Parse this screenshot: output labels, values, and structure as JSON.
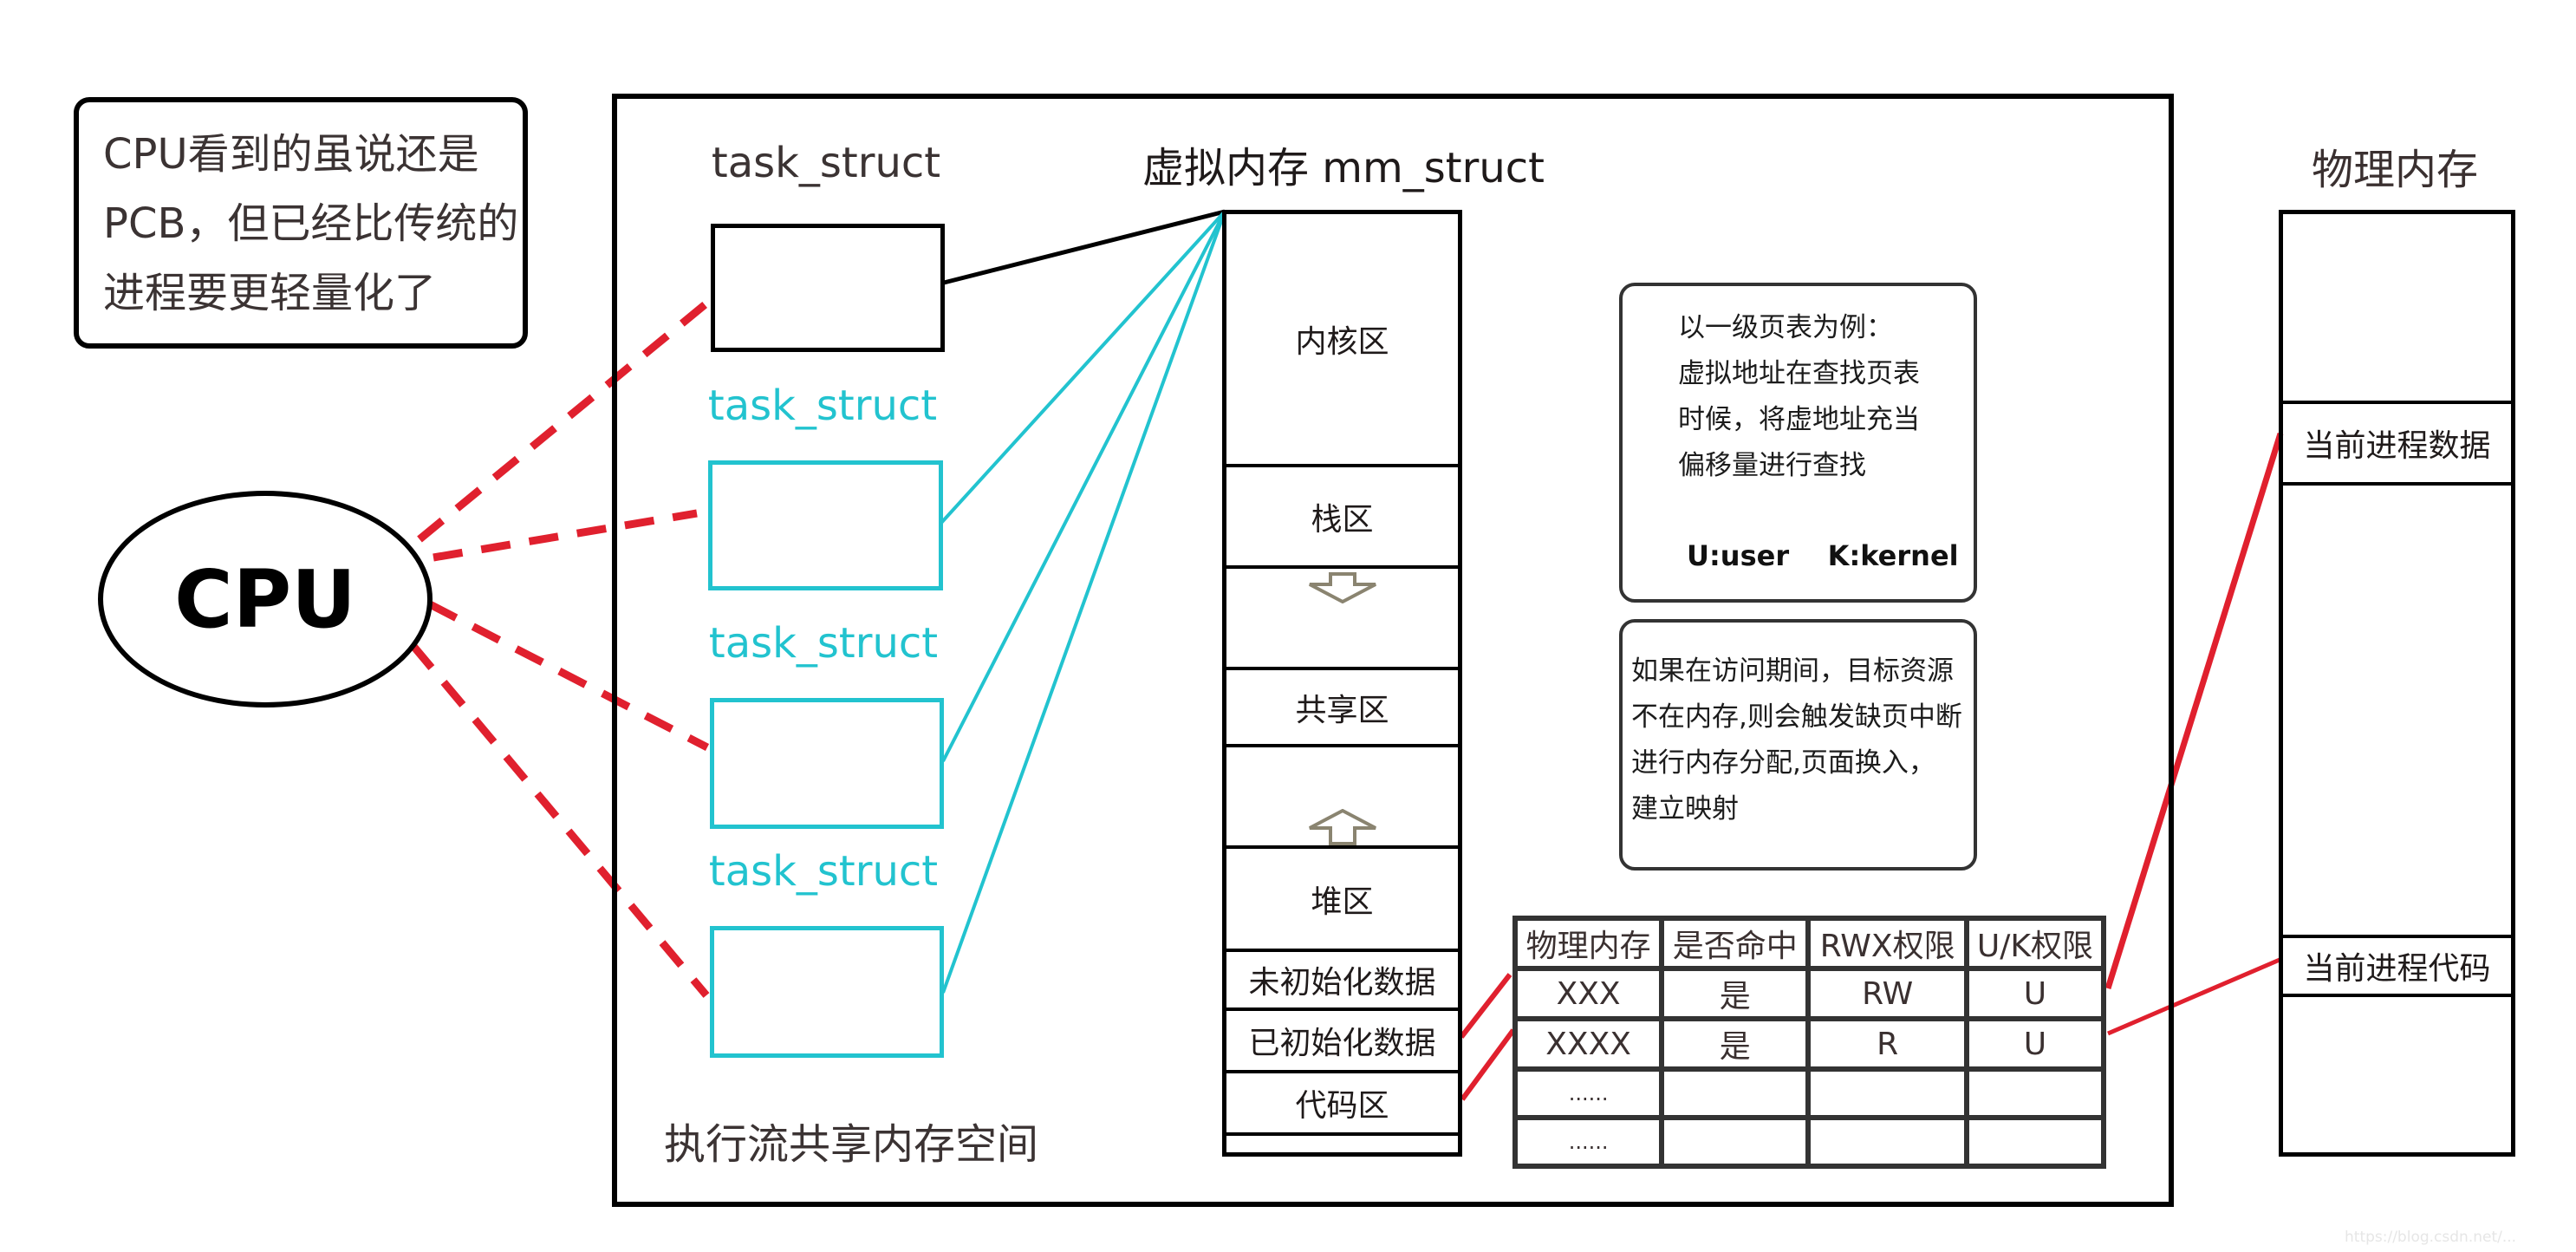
{
  "note": {
    "lines": [
      "CPU看到的虽说还是",
      "PCB，但已经比传统的",
      "进程要更轻量化了"
    ]
  },
  "cpu": {
    "label": "CPU"
  },
  "address_space": {
    "caption": "执行流共享内存空间",
    "task_structs": [
      {
        "label": "task_struct",
        "color": "#3b3333"
      },
      {
        "label": "task_struct",
        "color": "#22c3cf"
      },
      {
        "label": "task_struct",
        "color": "#22c3cf"
      },
      {
        "label": "task_struct",
        "color": "#22c3cf"
      }
    ],
    "mm_title": "虚拟内存 mm_struct",
    "virtual_memory_regions": [
      {
        "label": "内核区"
      },
      {
        "label": "栈区"
      },
      {
        "label": "",
        "arrow": "down"
      },
      {
        "label": "共享区"
      },
      {
        "label": "",
        "arrow": "up"
      },
      {
        "label": "堆区"
      },
      {
        "label": "未初始化数据"
      },
      {
        "label": "已初始化数据"
      },
      {
        "label": "代码区"
      },
      {
        "label": ""
      }
    ],
    "page_table_note": {
      "lines": [
        "以一级页表为例：",
        "虚拟地址在查找页表",
        "时候，将虚地址充当",
        "偏移量进行查找"
      ],
      "legend": "U:user    K:kernel"
    },
    "page_fault_note": {
      "lines": [
        "如果在访问期间，目标资源",
        "不在内存,则会触发缺页中断",
        "进行内存分配,页面换入，",
        "建立映射"
      ]
    },
    "page_table": {
      "headers": [
        "物理内存",
        "是否命中",
        "RWX权限",
        "U/K权限"
      ],
      "rows": [
        [
          "XXX",
          "是",
          "RW",
          "U"
        ],
        [
          "XXXX",
          "是",
          "R",
          "U"
        ],
        [
          "......",
          "",
          "",
          ""
        ],
        [
          "......",
          "",
          "",
          ""
        ]
      ]
    }
  },
  "physical_memory": {
    "title": "物理内存",
    "regions": [
      {
        "label": ""
      },
      {
        "label": "当前进程数据"
      },
      {
        "label": ""
      },
      {
        "label": "当前进程代码"
      },
      {
        "label": ""
      }
    ]
  },
  "colors": {
    "cpu_link": "#e0202e",
    "thread_link": "#22c3cf",
    "main_link": "#000000",
    "mapping_link": "#e0202e",
    "arrow": "#8a8470"
  },
  "watermark": "https://blog.csdn.net/..."
}
